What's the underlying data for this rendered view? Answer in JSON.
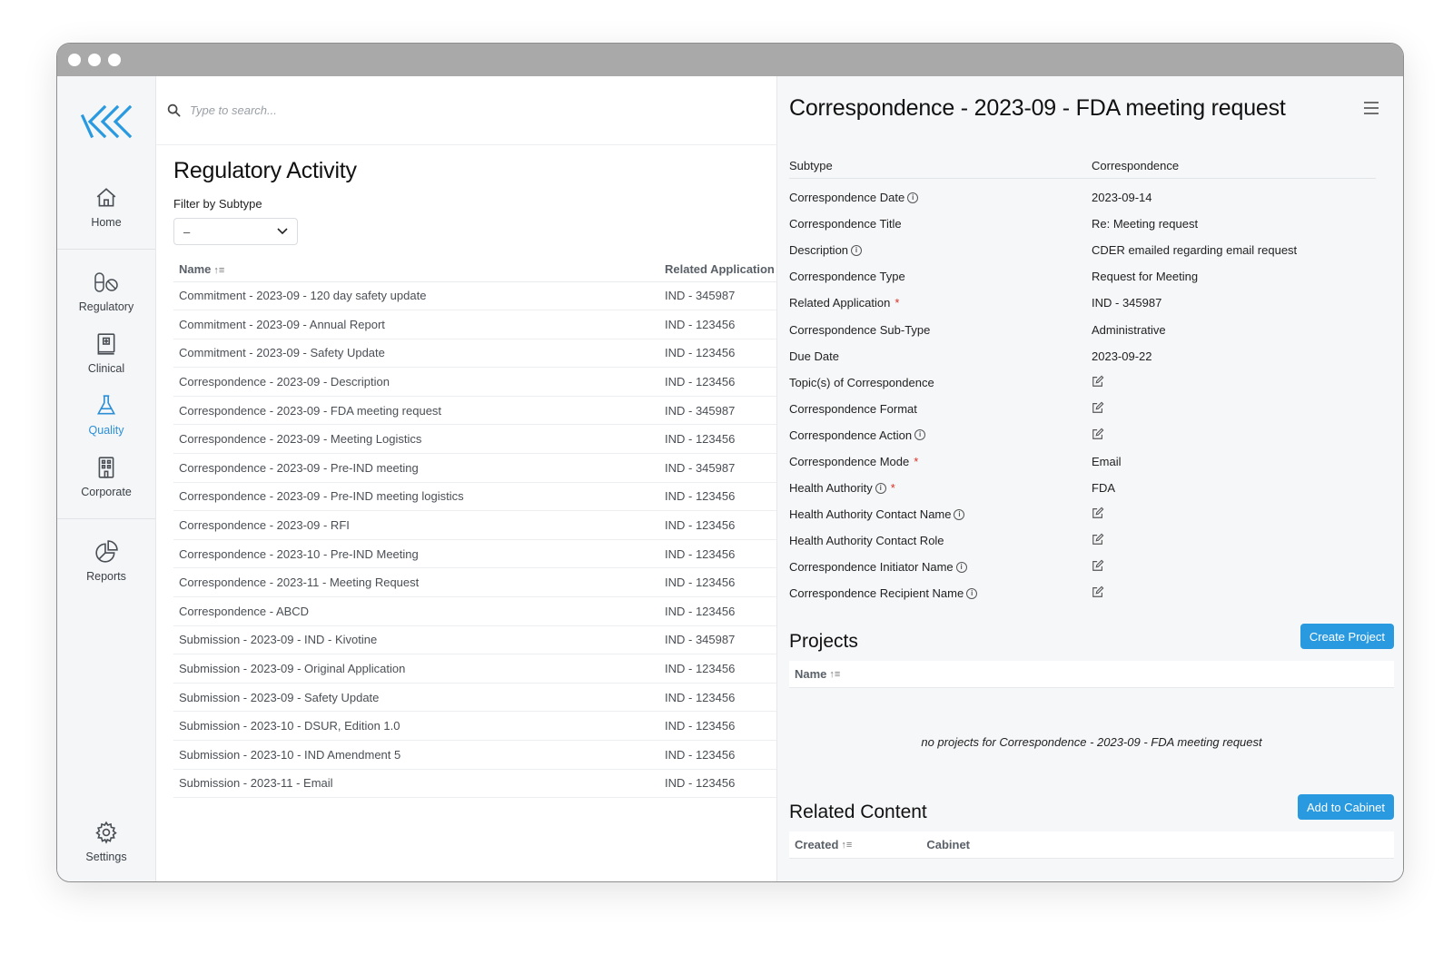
{
  "window": {
    "title": ""
  },
  "sidebar": {
    "items": [
      {
        "key": "home",
        "label": "Home",
        "icon": "home-icon"
      },
      {
        "key": "regulatory",
        "label": "Regulatory",
        "icon": "pills-icon"
      },
      {
        "key": "clinical",
        "label": "Clinical",
        "icon": "medical-book-icon"
      },
      {
        "key": "quality",
        "label": "Quality",
        "icon": "flask-icon",
        "active": true
      },
      {
        "key": "corporate",
        "label": "Corporate",
        "icon": "building-icon"
      },
      {
        "key": "reports",
        "label": "Reports",
        "icon": "pie-chart-icon"
      },
      {
        "key": "settings",
        "label": "Settings",
        "icon": "gear-icon"
      }
    ]
  },
  "search": {
    "placeholder": "Type to search..."
  },
  "list": {
    "title": "Regulatory Activity",
    "filter_label": "Filter by Subtype",
    "filter_value": "–",
    "columns": [
      "Name",
      "Related Application"
    ],
    "rows": [
      [
        "Commitment - 2023-09 - 120 day safety update",
        "IND - 345987"
      ],
      [
        "Commitment - 2023-09 - Annual Report",
        "IND - 123456"
      ],
      [
        "Commitment - 2023-09 - Safety Update",
        "IND - 123456"
      ],
      [
        "Correspondence - 2023-09 - Description",
        "IND - 123456"
      ],
      [
        "Correspondence - 2023-09 - FDA meeting request",
        "IND - 345987"
      ],
      [
        "Correspondence - 2023-09 - Meeting Logistics",
        "IND - 123456"
      ],
      [
        "Correspondence - 2023-09 - Pre-IND meeting",
        "IND - 345987"
      ],
      [
        "Correspondence - 2023-09 - Pre-IND meeting logistics",
        "IND - 123456"
      ],
      [
        "Correspondence - 2023-09 - RFI",
        "IND - 123456"
      ],
      [
        "Correspondence - 2023-10 - Pre-IND Meeting",
        "IND - 123456"
      ],
      [
        "Correspondence - 2023-11 - Meeting Request",
        "IND - 123456"
      ],
      [
        "Correspondence - ABCD",
        "IND - 123456"
      ],
      [
        "Submission - 2023-09 - IND - Kivotine",
        "IND - 345987"
      ],
      [
        "Submission - 2023-09 - Original Application",
        "IND - 123456"
      ],
      [
        "Submission - 2023-09 - Safety Update",
        "IND - 123456"
      ],
      [
        "Submission - 2023-10 - DSUR, Edition 1.0",
        "IND - 123456"
      ],
      [
        "Submission - 2023-10 - IND Amendment 5",
        "IND - 123456"
      ],
      [
        "Submission - 2023-11 - Email",
        "IND - 123456"
      ]
    ]
  },
  "detail": {
    "title": "Correspondence - 2023-09 - FDA meeting request",
    "fields": [
      {
        "label": "Subtype",
        "value": "Correspondence",
        "info": false,
        "required": false
      },
      {
        "label": "Correspondence Date",
        "value": "2023-09-14",
        "info": true,
        "required": false
      },
      {
        "label": "Correspondence Title",
        "value": "Re: Meeting request",
        "info": false,
        "required": false
      },
      {
        "label": "Description",
        "value": "CDER emailed regarding email request",
        "info": true,
        "required": false
      },
      {
        "label": "Correspondence Type",
        "value": "Request for Meeting",
        "info": false,
        "required": false
      },
      {
        "label": "Related Application",
        "value": "IND - 345987",
        "info": false,
        "required": true
      },
      {
        "label": "Correspondence Sub-Type",
        "value": "Administrative",
        "info": false,
        "required": false
      },
      {
        "label": "Due Date",
        "value": "2023-09-22",
        "info": false,
        "required": false
      },
      {
        "label": "Topic(s) of Correspondence",
        "value": null,
        "info": false,
        "required": false
      },
      {
        "label": "Correspondence Format",
        "value": null,
        "info": false,
        "required": false
      },
      {
        "label": "Correspondence Action",
        "value": null,
        "info": true,
        "required": false
      },
      {
        "label": "Correspondence Mode",
        "value": "Email",
        "info": false,
        "required": true
      },
      {
        "label": "Health Authority",
        "value": "FDA",
        "info": true,
        "required": true
      },
      {
        "label": "Health Authority Contact Name",
        "value": null,
        "info": true,
        "required": false
      },
      {
        "label": "Health Authority Contact Role",
        "value": null,
        "info": false,
        "required": false
      },
      {
        "label": "Correspondence Initiator Name",
        "value": null,
        "info": true,
        "required": false
      },
      {
        "label": "Correspondence Recipient Name",
        "value": null,
        "info": true,
        "required": false
      }
    ],
    "projects": {
      "title": "Projects",
      "button": "Create Project",
      "column": "Name",
      "empty": "no projects for Correspondence - 2023-09 - FDA meeting request"
    },
    "related": {
      "title": "Related Content",
      "button": "Add to Cabinet",
      "columns": [
        "Created",
        "Cabinet"
      ]
    }
  },
  "colors": {
    "accent": "#2a9ae0",
    "active_nav": "#2c8fd6",
    "logo": "#2a9ae0",
    "required": "#d93025"
  }
}
